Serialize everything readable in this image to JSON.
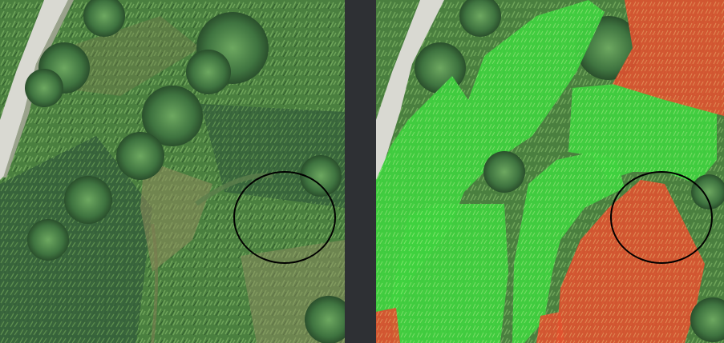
{
  "scene": {
    "description_free": true,
    "panels": [
      {
        "id": "original",
        "kind": "aerial-photo"
      },
      {
        "id": "segmentation",
        "kind": "aerial-photo-with-overlay"
      }
    ],
    "colors": {
      "background": "#2e3034",
      "vegetation_dark": "#2f5a2c",
      "vegetation_mid": "#4f8a45",
      "vegetation_light": "#7fae66",
      "soil": "#9a8a66",
      "road": "#d9d9d2",
      "overlay_green": "#3fd23f",
      "overlay_red": "#e0512f",
      "circle_stroke": "#000000"
    }
  }
}
